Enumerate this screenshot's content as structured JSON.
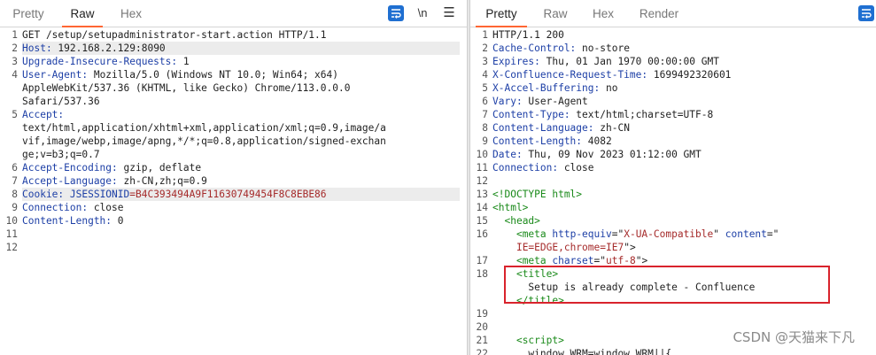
{
  "request": {
    "tabs": [
      "Pretty",
      "Raw",
      "Hex"
    ],
    "active_tab": "Raw",
    "newline_toggle": "\\n",
    "menu_icon": "hamburger-icon",
    "wrap_icon": "word-wrap-icon",
    "line_numbers": [
      "1",
      "2",
      "3",
      "4",
      "",
      "",
      "5",
      "",
      "",
      "",
      "6",
      "7",
      "8",
      "9",
      "10",
      "11",
      "12"
    ],
    "lines": [
      {
        "segments": [
          {
            "t": "GET /setup/setupadministrator-start.action HTTP/1.1",
            "c": ""
          }
        ]
      },
      {
        "segments": [
          {
            "t": "Host: ",
            "c": "k"
          },
          {
            "t": "192.168.2.129:8090",
            "c": ""
          }
        ],
        "highlight": true
      },
      {
        "segments": [
          {
            "t": "Upgrade-Insecure-Requests: ",
            "c": "k"
          },
          {
            "t": "1",
            "c": ""
          }
        ]
      },
      {
        "segments": [
          {
            "t": "User-Agent: ",
            "c": "k"
          },
          {
            "t": "Mozilla/5.0 (Windows NT 10.0; Win64; x64)",
            "c": ""
          }
        ]
      },
      {
        "segments": [
          {
            "t": "AppleWebKit/537.36 (KHTML, like Gecko) Chrome/113.0.0.0",
            "c": ""
          }
        ]
      },
      {
        "segments": [
          {
            "t": "Safari/537.36",
            "c": ""
          }
        ]
      },
      {
        "segments": [
          {
            "t": "Accept:",
            "c": "k"
          }
        ]
      },
      {
        "segments": [
          {
            "t": "text/html,application/xhtml+xml,application/xml;q=0.9,image/a",
            "c": ""
          }
        ]
      },
      {
        "segments": [
          {
            "t": "vif,image/webp,image/apng,*/*;q=0.8,application/signed-exchan",
            "c": ""
          }
        ]
      },
      {
        "segments": [
          {
            "t": "ge;v=b3;q=0.7",
            "c": ""
          }
        ]
      },
      {
        "segments": [
          {
            "t": "Accept-Encoding: ",
            "c": "k"
          },
          {
            "t": "gzip, deflate",
            "c": ""
          }
        ]
      },
      {
        "segments": [
          {
            "t": "Accept-Language: ",
            "c": "k"
          },
          {
            "t": "zh-CN,zh;q=0.9",
            "c": ""
          }
        ]
      },
      {
        "segments": [
          {
            "t": "Cookie: ",
            "c": "k"
          },
          {
            "t": "JSESSIONID",
            "c": "k"
          },
          {
            "t": "=B4C393494A9F11630749454F8C8EBE86",
            "c": "s"
          }
        ],
        "highlight": true
      },
      {
        "segments": [
          {
            "t": "Connection: ",
            "c": "k"
          },
          {
            "t": "close",
            "c": ""
          }
        ]
      },
      {
        "segments": [
          {
            "t": "Content-Length: ",
            "c": "k"
          },
          {
            "t": "0",
            "c": ""
          }
        ]
      },
      {
        "segments": [
          {
            "t": "",
            "c": ""
          }
        ]
      },
      {
        "segments": [
          {
            "t": "",
            "c": ""
          }
        ]
      }
    ]
  },
  "response": {
    "tabs": [
      "Pretty",
      "Raw",
      "Hex",
      "Render"
    ],
    "active_tab": "Pretty",
    "wrap_icon": "word-wrap-icon",
    "line_numbers": [
      "1",
      "2",
      "3",
      "4",
      "5",
      "6",
      "7",
      "8",
      "9",
      "10",
      "11",
      "12",
      "13",
      "14",
      "15",
      "16",
      "",
      "17",
      "18",
      "",
      "",
      "19",
      "20",
      "21",
      "22"
    ],
    "lines": [
      {
        "segments": [
          {
            "t": "HTTP/1.1 200",
            "c": ""
          }
        ]
      },
      {
        "segments": [
          {
            "t": "Cache-Control: ",
            "c": "k"
          },
          {
            "t": "no-store",
            "c": ""
          }
        ]
      },
      {
        "segments": [
          {
            "t": "Expires: ",
            "c": "k"
          },
          {
            "t": "Thu, 01 Jan 1970 00:00:00 GMT",
            "c": ""
          }
        ]
      },
      {
        "segments": [
          {
            "t": "X-Confluence-Request-Time: ",
            "c": "k"
          },
          {
            "t": "1699492320601",
            "c": ""
          }
        ]
      },
      {
        "segments": [
          {
            "t": "X-Accel-Buffering: ",
            "c": "k"
          },
          {
            "t": "no",
            "c": ""
          }
        ]
      },
      {
        "segments": [
          {
            "t": "Vary: ",
            "c": "k"
          },
          {
            "t": "User-Agent",
            "c": ""
          }
        ]
      },
      {
        "segments": [
          {
            "t": "Content-Type: ",
            "c": "k"
          },
          {
            "t": "text/html;charset=UTF-8",
            "c": ""
          }
        ]
      },
      {
        "segments": [
          {
            "t": "Content-Language: ",
            "c": "k"
          },
          {
            "t": "zh-CN",
            "c": ""
          }
        ]
      },
      {
        "segments": [
          {
            "t": "Content-Length: ",
            "c": "k"
          },
          {
            "t": "4082",
            "c": ""
          }
        ]
      },
      {
        "segments": [
          {
            "t": "Date: ",
            "c": "k"
          },
          {
            "t": "Thu, 09 Nov 2023 01:12:00 GMT",
            "c": ""
          }
        ]
      },
      {
        "segments": [
          {
            "t": "Connection: ",
            "c": "k"
          },
          {
            "t": "close",
            "c": ""
          }
        ]
      },
      {
        "segments": [
          {
            "t": "",
            "c": ""
          }
        ]
      },
      {
        "segments": [
          {
            "t": "<!DOCTYPE html>",
            "c": "tg"
          }
        ]
      },
      {
        "segments": [
          {
            "t": "<html>",
            "c": "tg"
          }
        ]
      },
      {
        "segments": [
          {
            "t": "  ",
            "c": ""
          },
          {
            "t": "<head>",
            "c": "tg"
          }
        ]
      },
      {
        "segments": [
          {
            "t": "    ",
            "c": ""
          },
          {
            "t": "<meta ",
            "c": "tg"
          },
          {
            "t": "http-equiv",
            "c": "at"
          },
          {
            "t": "=\"",
            "c": ""
          },
          {
            "t": "X-UA-Compatible",
            "c": "av"
          },
          {
            "t": "\" ",
            "c": ""
          },
          {
            "t": "content",
            "c": "at"
          },
          {
            "t": "=\"",
            "c": ""
          }
        ]
      },
      {
        "segments": [
          {
            "t": "    ",
            "c": ""
          },
          {
            "t": "IE=EDGE,chrome=IE7",
            "c": "av"
          },
          {
            "t": "\">",
            "c": ""
          }
        ]
      },
      {
        "segments": [
          {
            "t": "    ",
            "c": ""
          },
          {
            "t": "<meta ",
            "c": "tg"
          },
          {
            "t": "charset",
            "c": "at"
          },
          {
            "t": "=\"",
            "c": ""
          },
          {
            "t": "utf-8",
            "c": "av"
          },
          {
            "t": "\">",
            "c": ""
          }
        ]
      },
      {
        "segments": [
          {
            "t": "    ",
            "c": ""
          },
          {
            "t": "<title>",
            "c": "tg"
          }
        ]
      },
      {
        "segments": [
          {
            "t": "      Setup is already complete - Confluence",
            "c": ""
          }
        ]
      },
      {
        "segments": [
          {
            "t": "    ",
            "c": ""
          },
          {
            "t": "</title>",
            "c": "tg"
          }
        ]
      },
      {
        "segments": [
          {
            "t": "",
            "c": ""
          }
        ]
      },
      {
        "segments": [
          {
            "t": "",
            "c": ""
          }
        ]
      },
      {
        "segments": [
          {
            "t": "    ",
            "c": ""
          },
          {
            "t": "<script>",
            "c": "tg"
          }
        ]
      },
      {
        "segments": [
          {
            "t": "      window.WRM=window.WRM||{",
            "c": ""
          }
        ]
      }
    ]
  },
  "watermark": "CSDN @天猫来下凡"
}
